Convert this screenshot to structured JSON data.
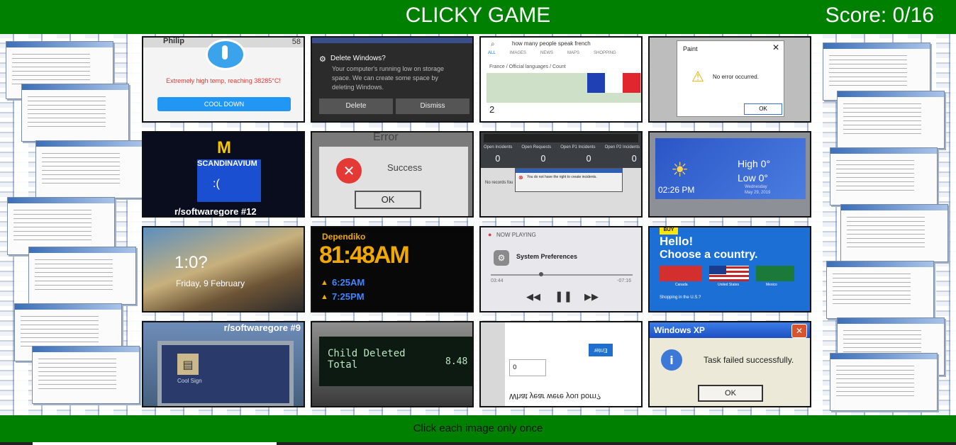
{
  "header": {
    "title": "CLICKY GAME",
    "score": "Score: 0/16"
  },
  "footer": {
    "instructions": "Click each image only once"
  },
  "cards": {
    "temp": {
      "name_top": "Philip",
      "badge": "58",
      "message": "Extremely high temp, reaching 38285°C!",
      "button": "COOL DOWN"
    },
    "delete": {
      "title": "Delete Windows?",
      "body": "Your computer's running low on storage space. We can create some space by deleting Windows.",
      "btn1": "Delete",
      "btn2": "Dismiss"
    },
    "search": {
      "query": "how many people speak french",
      "tabs": [
        "ALL",
        "IMAGES",
        "NEWS",
        "MAPS",
        "SHOPPING"
      ],
      "crumb": "France / Official languages / Count",
      "answer": "2"
    },
    "paint": {
      "title": "Paint",
      "message": "No error occurred.",
      "button": "OK"
    },
    "mcd": {
      "sign": "SCANDINAVIUM",
      "face": ":(",
      "caption": "r/softwaregore #12"
    },
    "success": {
      "title": "Error",
      "message": "Success",
      "button": "OK"
    },
    "incidents": {
      "cols": [
        "Open Incidents",
        "Open Requests",
        "Open P1 Incidents",
        "Open P2 Incidents"
      ],
      "values": [
        "0",
        "0",
        "0",
        "0"
      ],
      "dialog": "You do not have the right to create incidents.",
      "row": "No records fou"
    },
    "weather": {
      "high": "High 0°",
      "low": "Low  0°",
      "time": "02:26 PM",
      "day": "Wednesday",
      "date": "May 29, 2019"
    },
    "lock": {
      "time": "1:0?",
      "date": "Friday, 9 February"
    },
    "clock": {
      "top": "Dependiko",
      "time": "81:48AM",
      "sunrise": "6:25AM",
      "sunset": "7:25PM"
    },
    "player": {
      "header": "NOW PLAYING",
      "track": "System Preferences",
      "elapsed": "03:44",
      "remaining": "-07:16"
    },
    "bestbuy": {
      "logo": "BUY",
      "greeting": "Hello!",
      "prompt": "Choose a country.",
      "countries": [
        "Canada",
        "United States",
        "Mexico"
      ],
      "note": "Shopping in the U.S.?"
    },
    "coolsign": {
      "caption": "r/softwaregore #9",
      "label": "Cool Sign"
    },
    "child": {
      "line1": "Child Deleted",
      "line2": "Total",
      "amount": "8.48"
    },
    "birth": {
      "button": "Enter",
      "value": "0",
      "question": "What year were you born?"
    },
    "xp": {
      "title": "Windows XP",
      "message": "Task failed successfully.",
      "button": "OK"
    }
  }
}
